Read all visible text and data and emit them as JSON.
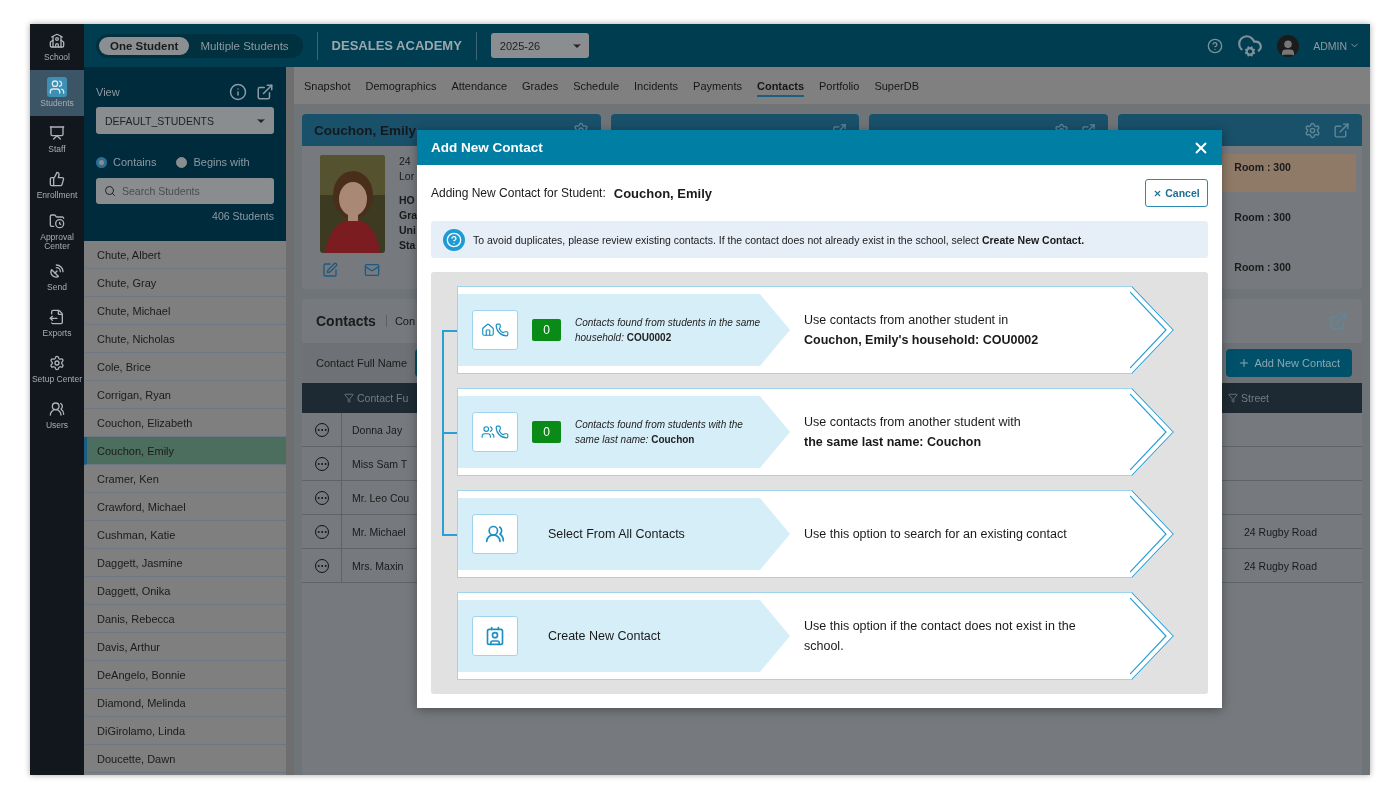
{
  "nav": [
    {
      "label": "School",
      "selected": false
    },
    {
      "label": "Students",
      "selected": true
    },
    {
      "label": "Staff",
      "selected": false
    },
    {
      "label": "Enrollment",
      "selected": false
    },
    {
      "label": "Approval Center",
      "selected": false
    },
    {
      "label": "Send",
      "selected": false
    },
    {
      "label": "Exports",
      "selected": false
    },
    {
      "label": "Setup Center",
      "selected": false
    },
    {
      "label": "Users",
      "selected": false
    }
  ],
  "top_bar": {
    "modes": [
      {
        "label": "One Student",
        "selected": true
      },
      {
        "label": "Multiple Students",
        "selected": false
      }
    ],
    "school": "DESALES ACADEMY",
    "year": "2025-26",
    "user": "ADMIN"
  },
  "student_panel": {
    "view_label": "View",
    "view": "DEFAULT_STUDENTS",
    "match": [
      {
        "label": "Contains",
        "selected": true
      },
      {
        "label": "Begins with",
        "selected": false
      }
    ],
    "search_placeholder": "Search Students",
    "count": "406 Students",
    "students": [
      {
        "name": "Chute, Albert",
        "selected": false
      },
      {
        "name": "Chute, Gray",
        "selected": false
      },
      {
        "name": "Chute, Michael",
        "selected": false
      },
      {
        "name": "Chute, Nicholas",
        "selected": false
      },
      {
        "name": "Cole, Brice",
        "selected": false
      },
      {
        "name": "Corrigan, Ryan",
        "selected": false
      },
      {
        "name": "Couchon, Elizabeth",
        "selected": false
      },
      {
        "name": "Couchon, Emily",
        "selected": true
      },
      {
        "name": "Cramer, Ken",
        "selected": false
      },
      {
        "name": "Crawford, Michael",
        "selected": false
      },
      {
        "name": "Cushman, Katie",
        "selected": false
      },
      {
        "name": "Daggett, Jasmine",
        "selected": false
      },
      {
        "name": "Daggett, Onika",
        "selected": false
      },
      {
        "name": "Danis, Rebecca",
        "selected": false
      },
      {
        "name": "Davis, Arthur",
        "selected": false
      },
      {
        "name": "DeAngelo, Bonnie",
        "selected": false
      },
      {
        "name": "Diamond, Melinda",
        "selected": false
      },
      {
        "name": "DiGirolamo, Linda",
        "selected": false
      },
      {
        "name": "Doucette, Dawn",
        "selected": false
      }
    ]
  },
  "tabs": [
    {
      "label": "Snapshot",
      "selected": false
    },
    {
      "label": "Demographics",
      "selected": false
    },
    {
      "label": "Attendance",
      "selected": false
    },
    {
      "label": "Grades",
      "selected": false
    },
    {
      "label": "Schedule",
      "selected": false
    },
    {
      "label": "Incidents",
      "selected": false
    },
    {
      "label": "Payments",
      "selected": false
    },
    {
      "label": "Contacts",
      "selected": true
    },
    {
      "label": "Portfolio",
      "selected": false
    },
    {
      "label": "SuperDB",
      "selected": false
    }
  ],
  "student_card": {
    "name": "Couchon, Emily",
    "lines": [
      "24",
      "Lor"
    ],
    "fields": [
      "HO",
      "Gra",
      "Uni",
      "Sta"
    ]
  },
  "schedule": {
    "rooms": [
      {
        "text": "Room : 300",
        "highlighted": true
      },
      {
        "text": "Room : 300",
        "highlighted": false
      },
      {
        "text": "Room : 300",
        "highlighted": false
      }
    ]
  },
  "contacts": {
    "title": "Contacts",
    "tab": "Con",
    "filter_label": "Contact Full Name",
    "add_button": "Add New Contact",
    "columns": [
      "Contact Fu",
      "Street"
    ],
    "rows": [
      {
        "name": "Donna Jay"
      },
      {
        "name": "Miss Sam T"
      },
      {
        "name": "Mr. Leo Cou"
      },
      {
        "name": "Mr. Michael",
        "street": "24 Rugby Road"
      },
      {
        "name": "Mrs. Maxin",
        "street": "24 Rugby Road"
      }
    ]
  },
  "modal": {
    "title": "Add New Contact",
    "student_label": "Adding New Contact for Student:",
    "student": "Couchon, Emily",
    "cancel": "Cancel",
    "notice": "To avoid duplicates, please review existing contacts. If the contact does not already exist in the school, select **Create New Contact.**",
    "options": [
      {
        "kind": "count",
        "count": "0",
        "caption": "*Contacts found from students in the same household:* **COU0002**",
        "description": "Use contacts from another student in",
        "emphasis": "Couchon, Emily's household: COU0002"
      },
      {
        "kind": "count",
        "count": "0",
        "caption": "*Contacts found from students with the same last name:* **Couchon**",
        "description": "Use contacts from another student with",
        "emphasis": "the same last name: Couchon"
      },
      {
        "kind": "plain",
        "label": "Select From All Contacts",
        "description": "Use this option to search for an existing contact"
      },
      {
        "kind": "plain",
        "label": "Create New Contact",
        "description": "Use this option if the contact does not exist in the school."
      }
    ]
  }
}
